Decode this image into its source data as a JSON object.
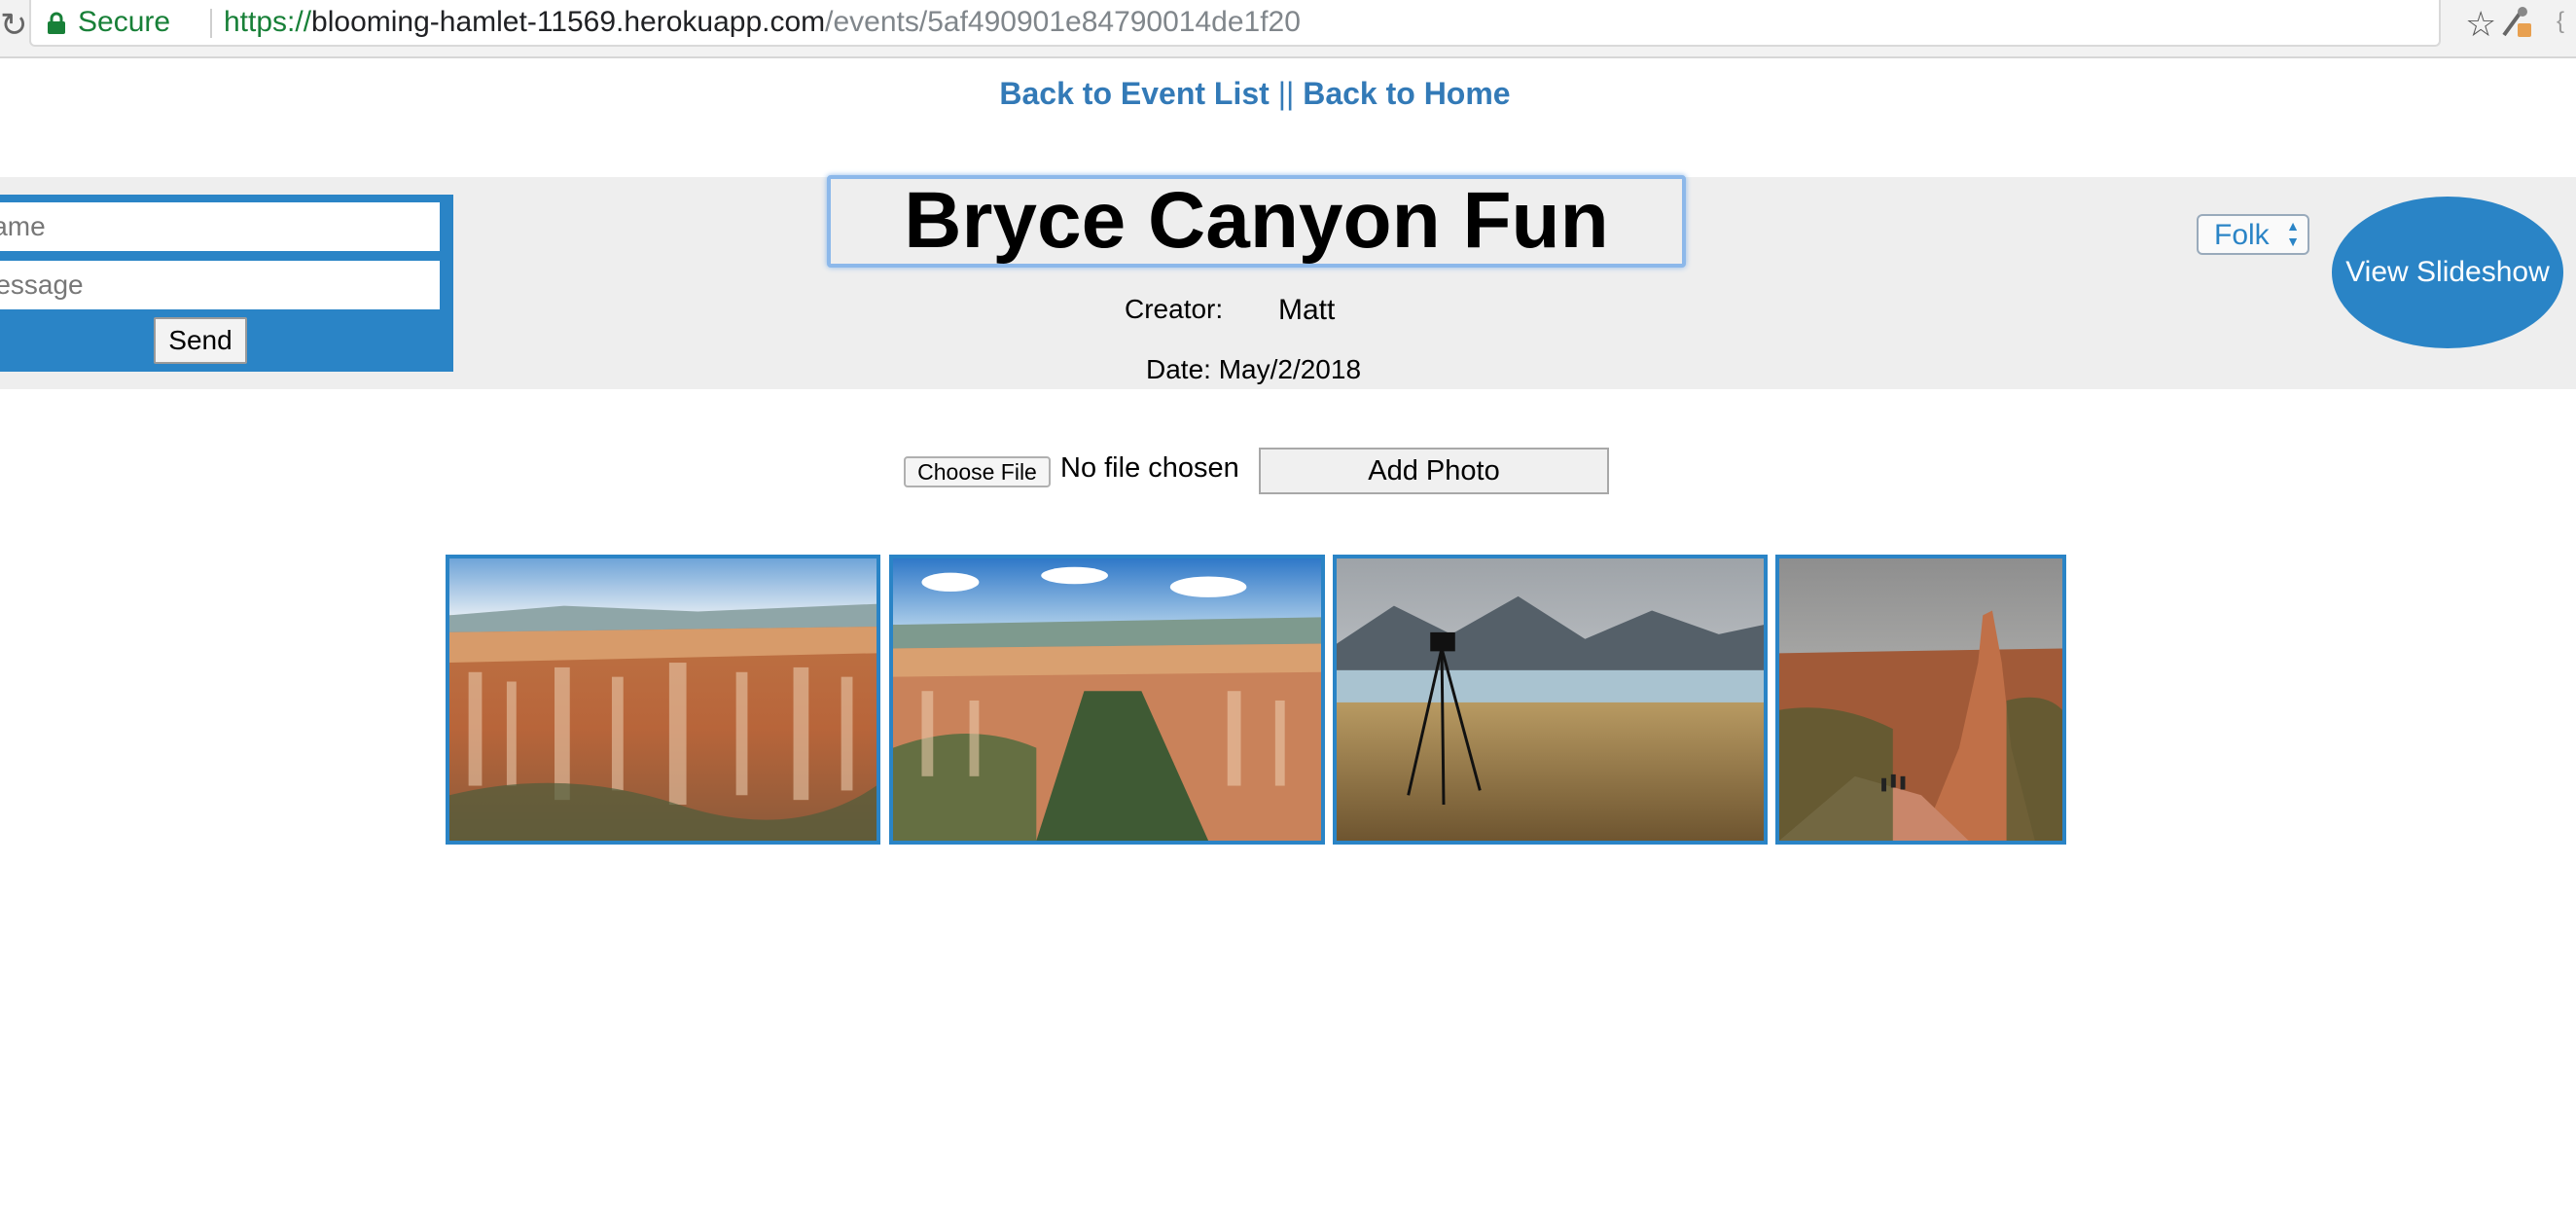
{
  "browser": {
    "secure_label": "Secure",
    "url_scheme": "https://",
    "url_host": "blooming-hamlet-11569.herokuapp.com",
    "url_path": "/events/5af490901e84790014de1f20",
    "icons": [
      "reload-icon",
      "lock-icon",
      "star-icon",
      "extension-icon"
    ]
  },
  "nav": {
    "back_to_events": "Back to Event List",
    "separator": "||",
    "back_to_home": "Back to Home"
  },
  "chat": {
    "name_placeholder": "Name",
    "message_placeholder": "Message",
    "send_label": "Send"
  },
  "event": {
    "title": "Bryce Canyon Fun",
    "creator_label": "Creator:",
    "creator_name": "Matt",
    "date_label": "Date: May/2/2018"
  },
  "genre": {
    "selected": "Folk"
  },
  "slideshow": {
    "label": "View Slideshow"
  },
  "upload": {
    "choose_label": "Choose File",
    "status": "No file chosen",
    "add_label": "Add Photo"
  },
  "gallery": {
    "photos": [
      {
        "subject": "Bryce Canyon hoodoos amphitheater"
      },
      {
        "subject": "Bryce Canyon aerial view with forest"
      },
      {
        "subject": "Camera tripod on grassland by lake and mountains"
      },
      {
        "subject": "Red rock spire with hikers on trail"
      }
    ]
  },
  "colors": {
    "accent": "#2a84c6",
    "link": "#337ab7",
    "band": "#eeeeee"
  }
}
